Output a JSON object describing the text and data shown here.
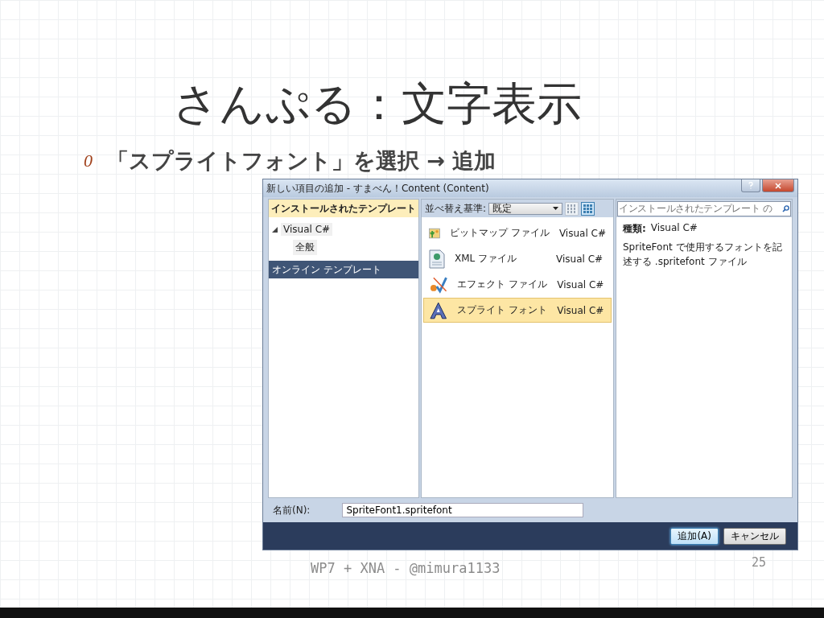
{
  "slide": {
    "title": "さんぷる：文字表示",
    "bullets": [
      {
        "marker": "0",
        "text": "「スプライトフォント」を選択 → 追加"
      }
    ],
    "footer": "WP7 + XNA - @mimura1133",
    "page_number": "25"
  },
  "dialog": {
    "title": "新しい項目の追加 - すまべん！Content (Content)",
    "left_panel": {
      "header": "インストールされたテンプレート",
      "tree": [
        {
          "label": "Visual C#",
          "expanded": true,
          "selected": false,
          "children": [
            {
              "label": "全般",
              "selected": false
            }
          ]
        },
        {
          "label": "オンライン テンプレート",
          "selected": true
        }
      ]
    },
    "sort": {
      "label": "並べ替え基準:",
      "value": "既定"
    },
    "views": [
      {
        "selected": false
      },
      {
        "selected": true
      }
    ],
    "search": {
      "placeholder": "インストールされたテンプレート の"
    },
    "templates": [
      {
        "kind": "bitmap",
        "name": "ビットマップ ファイル",
        "language": "Visual C#",
        "selected": false
      },
      {
        "kind": "xml",
        "name": "XML ファイル",
        "language": "Visual C#",
        "selected": false
      },
      {
        "kind": "effect",
        "name": "エフェクト ファイル",
        "language": "Visual C#",
        "selected": false
      },
      {
        "kind": "font",
        "name": "スプライト フォント",
        "language": "Visual C#",
        "selected": true
      }
    ],
    "details": {
      "type_label": "種類:",
      "type_value": "Visual C#",
      "description": "SpriteFont で使用するフォントを記述する .spritefont ファイル"
    },
    "name_field": {
      "label": "名前(N):",
      "value": "SpriteFont1.spritefont"
    },
    "buttons": [
      {
        "label": "追加(A)",
        "default": true
      },
      {
        "label": "キャンセル",
        "default": false
      }
    ]
  }
}
